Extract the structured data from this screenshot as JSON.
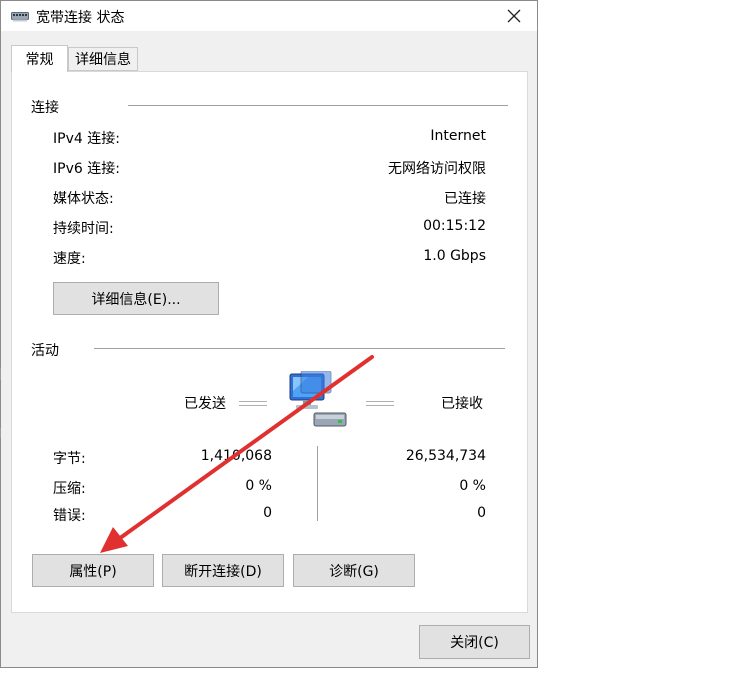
{
  "window": {
    "title": "宽带连接 状态",
    "title_icon": "network-adapter-icon",
    "close_icon": "close-icon"
  },
  "tabs": [
    {
      "label": "常规",
      "active": true
    },
    {
      "label": "详细信息",
      "active": false
    }
  ],
  "connection": {
    "heading": "连接",
    "rows": [
      {
        "label": "IPv4 连接:",
        "value": "Internet"
      },
      {
        "label": "IPv6 连接:",
        "value": "无网络访问权限"
      },
      {
        "label": "媒体状态:",
        "value": "已连接"
      },
      {
        "label": "持续时间:",
        "value": "00:15:12"
      },
      {
        "label": "速度:",
        "value": "1.0 Gbps"
      }
    ],
    "details_button": "详细信息(E)..."
  },
  "activity": {
    "heading": "活动",
    "sent_label": "已发送",
    "received_label": "已接收",
    "icon": "network-computers-icon",
    "rows": [
      {
        "label": "字节:",
        "sent": "1,410,068",
        "received": "26,534,734"
      },
      {
        "label": "压缩:",
        "sent": "0 %",
        "received": "0 %"
      },
      {
        "label": "错误:",
        "sent": "0",
        "received": "0"
      }
    ]
  },
  "buttons": {
    "properties": "属性(P)",
    "disconnect": "断开连接(D)",
    "diagnose": "诊断(G)",
    "close": "关闭(C)"
  },
  "annotation": {
    "color": "#e03030",
    "description_icon": "red-arrow-annotation"
  }
}
